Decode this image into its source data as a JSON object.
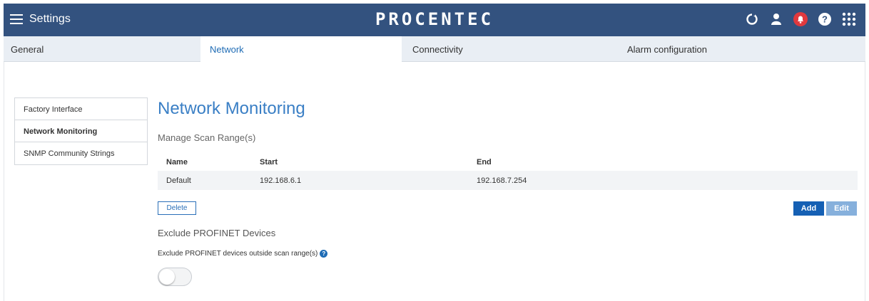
{
  "header": {
    "settings_label": "Settings",
    "brand": "PROCENTEC",
    "icons": [
      "refresh-icon",
      "user-icon",
      "bell-icon",
      "help-icon",
      "apps-grid-icon"
    ],
    "colors": {
      "bar": "#33527f",
      "alert": "#e0393e"
    }
  },
  "tabs": [
    {
      "label": "General"
    },
    {
      "label": "Network"
    },
    {
      "label": "Connectivity"
    },
    {
      "label": "Alarm configuration"
    }
  ],
  "sidebar": {
    "items": [
      {
        "label": "Factory Interface"
      },
      {
        "label": "Network Monitoring"
      },
      {
        "label": "SNMP Community Strings"
      }
    ]
  },
  "main": {
    "title": "Network Monitoring",
    "scan_title": "Manage Scan Range(s)",
    "table": {
      "headers": {
        "name": "Name",
        "start": "Start",
        "end": "End"
      },
      "rows": [
        {
          "name": "Default",
          "start": "192.168.6.1",
          "end": "192.168.7.254"
        }
      ]
    },
    "delete_label": "Delete",
    "add_label": "Add",
    "edit_label": "Edit",
    "exclude_title": "Exclude PROFINET Devices",
    "exclude_label": "Exclude PROFINET devices outside scan range(s)",
    "exclude_toggle_on": false
  }
}
